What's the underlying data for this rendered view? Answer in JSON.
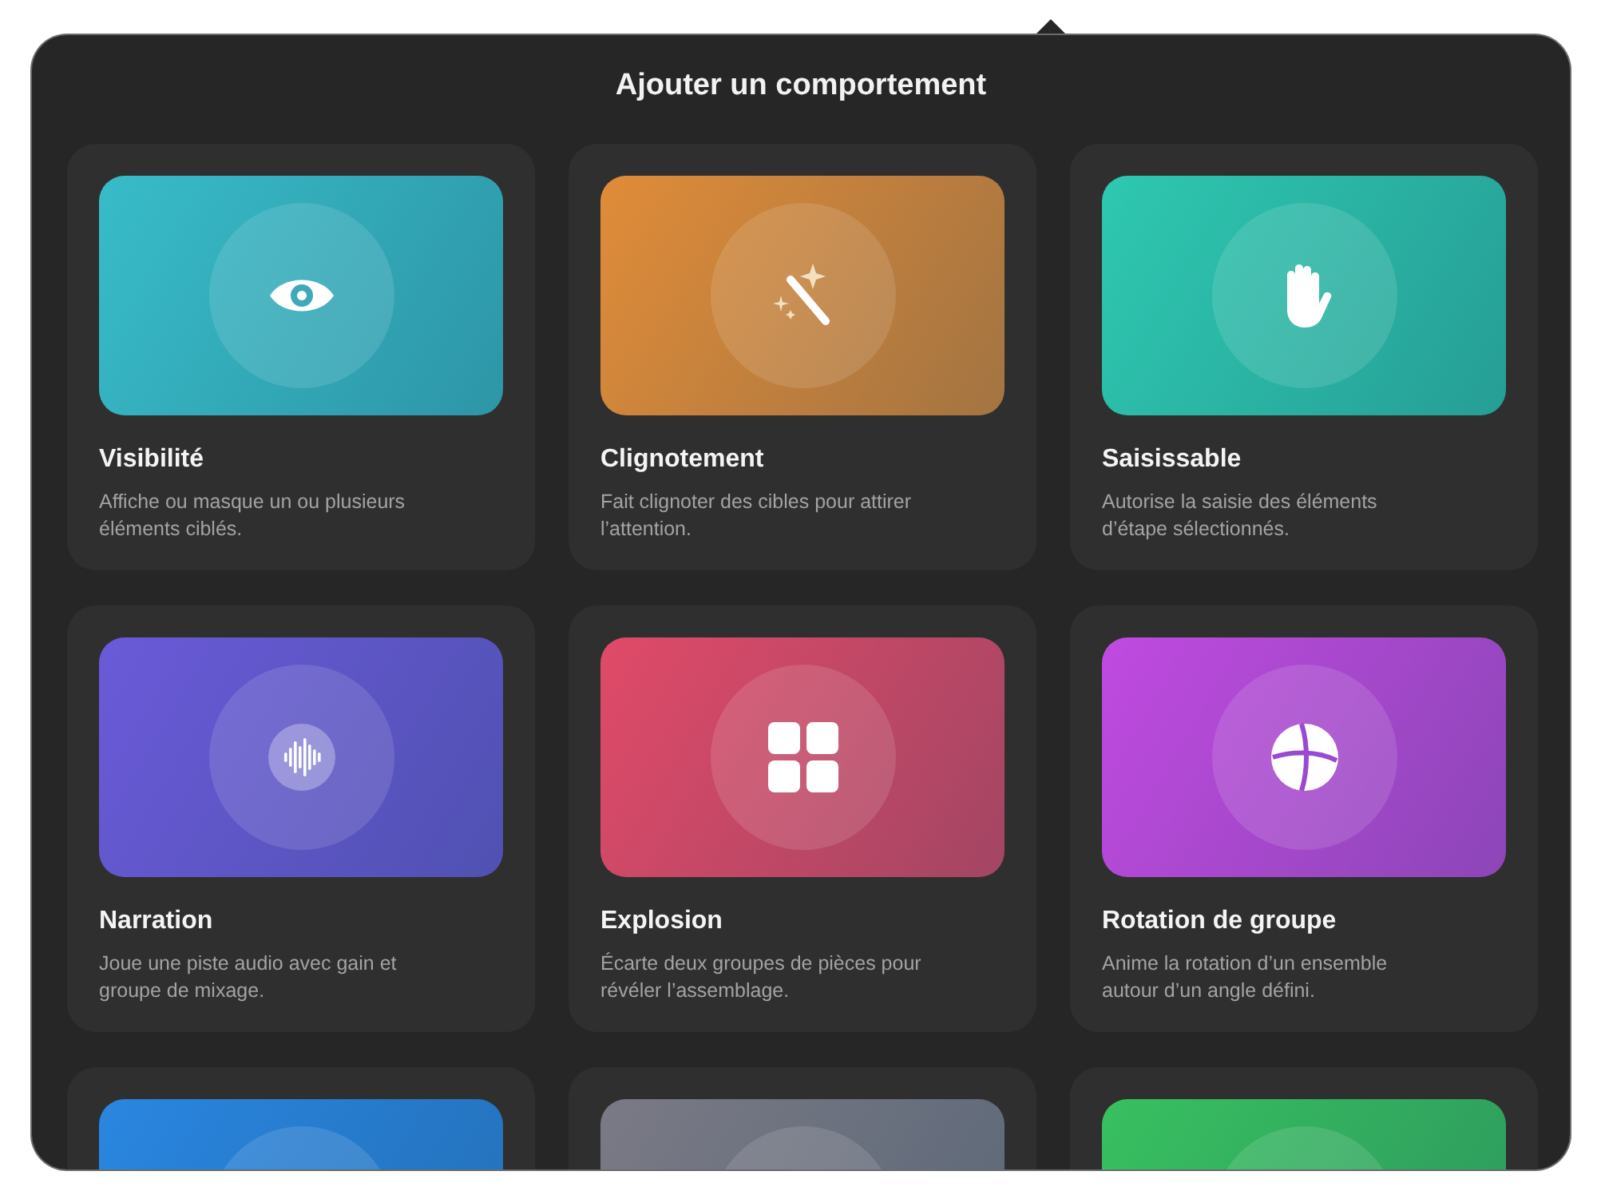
{
  "popover": {
    "title": "Ajouter un comportement"
  },
  "behaviors": [
    {
      "kind": "eye",
      "title": "Visibilité",
      "description": "Affiche ou masque un ou plusieurs éléments ciblés.",
      "color": "#38bcc8"
    },
    {
      "kind": "wand",
      "title": "Clignotement",
      "description": "Fait clignoter des cibles pour attirer l’attention.",
      "color": "#e08c38"
    },
    {
      "kind": "hand",
      "title": "Saisissable",
      "description": "Autorise la saisie des éléments d’étape sélectionnés.",
      "color": "#2ec8b0"
    },
    {
      "kind": "waveform",
      "title": "Narration",
      "description": "Joue une piste audio avec gain et groupe de mixage.",
      "color": "#6a5ad8"
    },
    {
      "kind": "grid",
      "title": "Explosion",
      "description": "Écarte deux groupes de pièces pour révéler l’assemblage.",
      "color": "#e04a68"
    },
    {
      "kind": "globe",
      "title": "Rotation de groupe",
      "description": "Anime la rotation d’un ensemble autour d’un angle défini.",
      "color": "#c04ae0"
    },
    {
      "kind": "none",
      "color": "#2a86e0"
    },
    {
      "kind": "none",
      "color": "#7a7a85"
    },
    {
      "kind": "none",
      "color": "#38c060"
    }
  ]
}
